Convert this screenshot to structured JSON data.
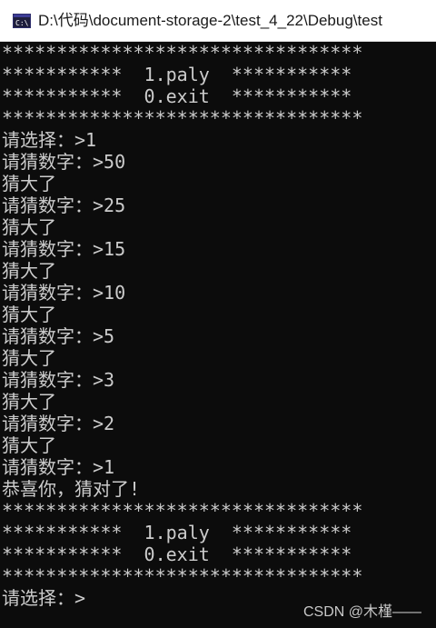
{
  "window": {
    "title": "D:\\代码\\document-storage-2\\test_4_22\\Debug\\test"
  },
  "icons": {
    "app_icon": "console-icon"
  },
  "colors": {
    "console_background": "#0c0c0c",
    "console_text": "#cccccc",
    "titlebar_background": "#ffffff"
  },
  "console": {
    "lines": [
      "*********************************",
      "***********  1.paly  ***********",
      "***********  0.exit  ***********",
      "*********************************",
      "请选择：>1",
      "请猜数字：>50",
      "猜大了",
      "请猜数字：>25",
      "猜大了",
      "请猜数字：>15",
      "猜大了",
      "请猜数字：>10",
      "猜大了",
      "请猜数字：>5",
      "猜大了",
      "请猜数字：>3",
      "猜大了",
      "请猜数字：>2",
      "猜大了",
      "请猜数字：>1",
      "恭喜你，猜对了!",
      "*********************************",
      "***********  1.paly  ***********",
      "***********  0.exit  ***********",
      "*********************************",
      "请选择：>"
    ]
  },
  "watermark": "CSDN @木槿——"
}
